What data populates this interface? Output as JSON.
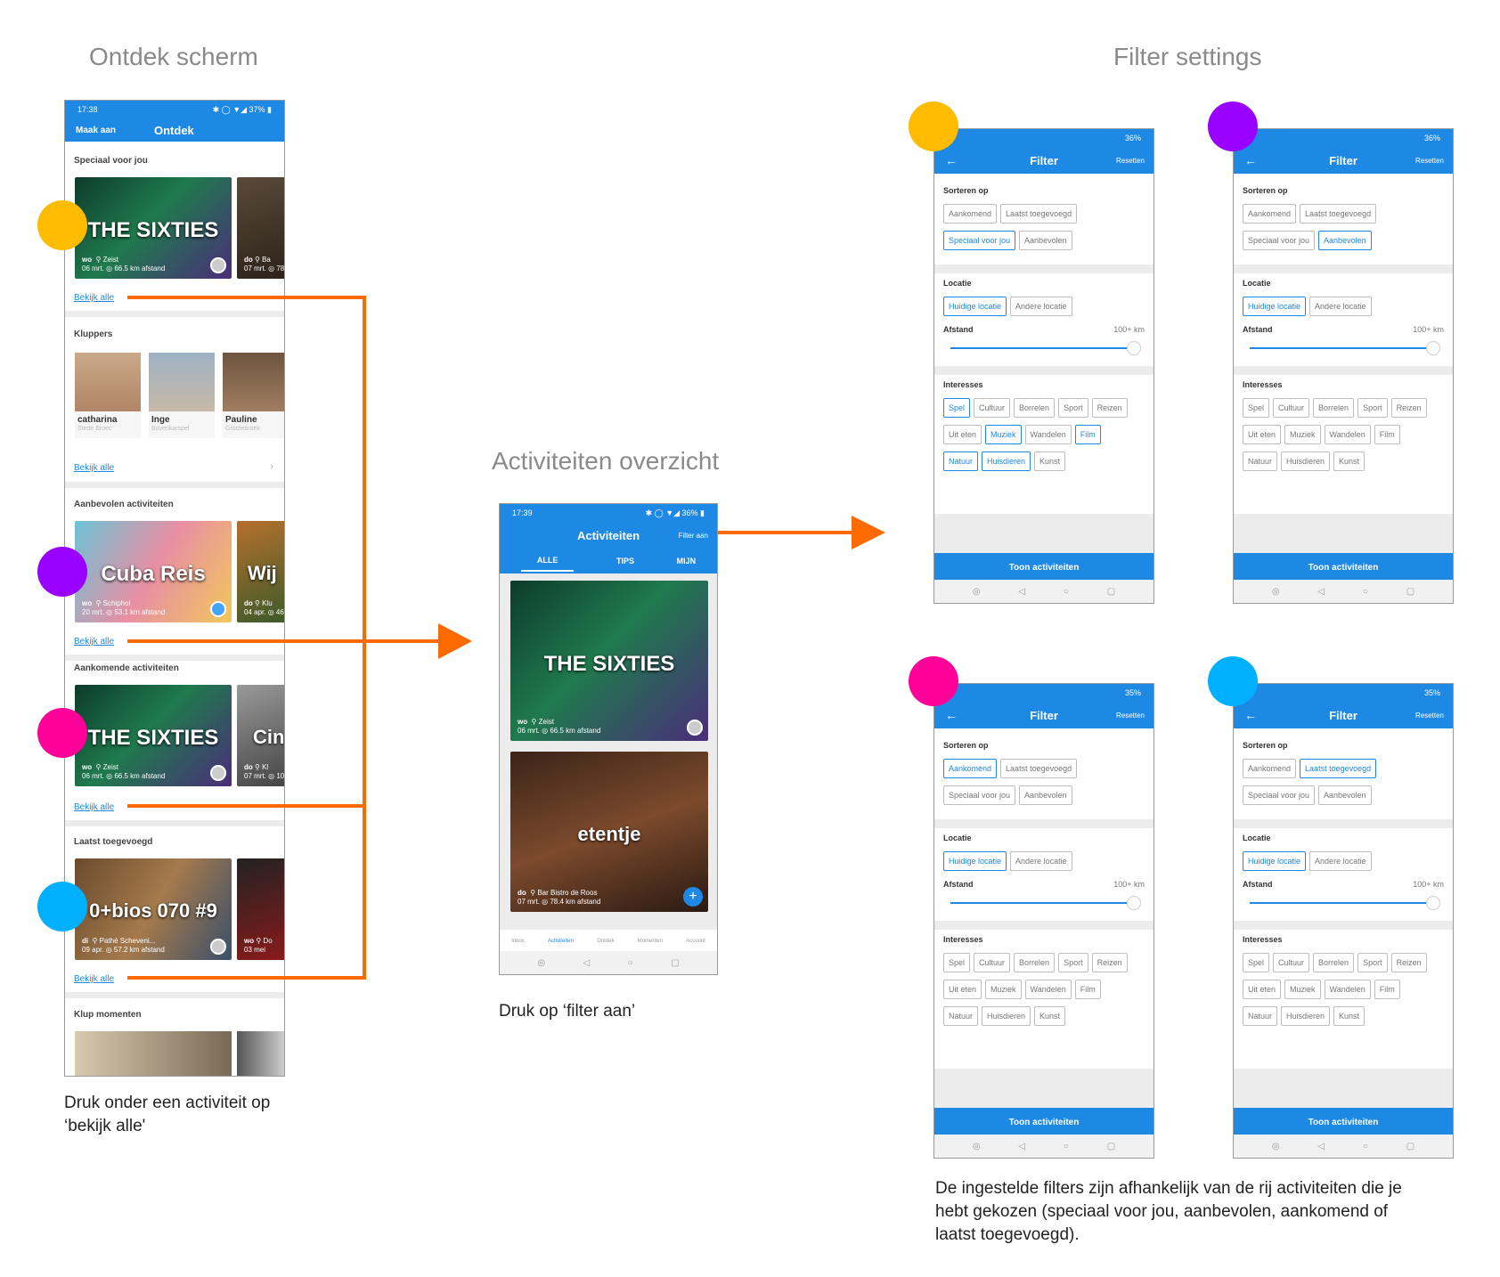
{
  "headings": {
    "ontdek": "Ontdek scherm",
    "overzicht": "Activiteiten overzicht",
    "filter": "Filter settings"
  },
  "captions": {
    "ontdek": [
      "Druk onder een activiteit op",
      "‘bekijk alle'"
    ],
    "overzicht": "Druk op ‘filter aan’",
    "filter": [
      "De ingestelde filters zijn afhankelijk van de rij activiteiten die je",
      "hebt gekozen (speciaal voor jou, aanbevolen, aankomend of",
      "laatst toegevoegd)."
    ]
  },
  "colors": {
    "accent_blue": "#1e88e5",
    "arrow_orange": "#ff6a00",
    "dot_yellow": "#ffbb00",
    "dot_purple": "#9900ff",
    "dot_pink": "#ff0099",
    "dot_cyan": "#00b0ff"
  },
  "ontdek_phone": {
    "status_time": "17:38",
    "status_right": "✱ ◯ ▼◢ 37% ▮",
    "maak_aan": "Maak aan",
    "title": "Ontdek",
    "bekijk_alle": "Bekijk alle",
    "sections": {
      "speciaal": "Speciaal voor jou",
      "kluppers": "Kluppers",
      "aanbevolen": "Aanbevolen activiteiten",
      "aankomend": "Aankomende activiteiten",
      "laatst": "Laatst toegevoegd",
      "momenten": "Klup momenten"
    },
    "cards": {
      "sixties": {
        "title": "THE SIXTIES",
        "day": "wo",
        "date": "06 mrt.",
        "place": "Zeist",
        "dist": "66.5 km afstand"
      },
      "cuba": {
        "title": "Cuba Reis",
        "day": "wo",
        "date": "20 mrt.",
        "place": "Schiphol",
        "dist": "53.1 km afstand"
      },
      "bios": {
        "title": "0+bios 070 #9",
        "day": "di",
        "date": "09 apr.",
        "place": "Pathé Scheveni...",
        "dist": "57.2 km afstand"
      },
      "peek_sixties": {
        "title": "",
        "day": "do",
        "date": "07 mrt.",
        "place": "Ba",
        "dist": "78"
      },
      "peek_wij": {
        "title": "Wij",
        "day": "do",
        "date": "04 apr.",
        "place": "Klu",
        "dist": "46"
      },
      "peek_cin": {
        "title": "Cin",
        "day": "do",
        "date": "07 mrt.",
        "place": "Kl",
        "dist": "10"
      },
      "peek_bios": {
        "title": "",
        "day": "wo",
        "date": "03 mei",
        "place": "Do",
        "dist": ""
      }
    },
    "kluppers": [
      {
        "name": "catharina",
        "place": "Stede Broec"
      },
      {
        "name": "Inge",
        "place": "Bovenkarspel"
      },
      {
        "name": "Pauline",
        "place": "Grootebroek"
      }
    ]
  },
  "activiteiten_phone": {
    "status_time": "17:39",
    "status_right": "✱ ◯ ▼◢ 36% ▮",
    "title": "Activiteiten",
    "filter_aan": "Filter aan",
    "tabs": [
      "ALLE",
      "TIPS",
      "MIJN"
    ],
    "cards": [
      {
        "title": "THE SIXTIES",
        "day": "wo",
        "date": "06 mrt.",
        "place": "Zeist",
        "dist": "66.5 km afstand"
      },
      {
        "title": "etentje",
        "day": "do",
        "date": "07 mrt.",
        "place": "Bar Bistro de Roos",
        "dist": "78.4 km afstand"
      }
    ],
    "bottom_nav": [
      "Inbox",
      "Activiteiten",
      "Ontdek",
      "Momenten",
      "Account"
    ]
  },
  "filter_common": {
    "title": "Filter",
    "resetten": "Resetten",
    "sorteren_op": "Sorteren op",
    "sort_options": [
      "Aankomend",
      "Laatst toegevoegd",
      "Speciaal voor jou",
      "Aanbevolen"
    ],
    "locatie": "Locatie",
    "locatie_options": [
      "Huidige locatie",
      "Andere locatie"
    ],
    "afstand": "Afstand",
    "afstand_value": "100+ km",
    "interesses": "Interesses",
    "interesse_options": [
      "Spel",
      "Cultuur",
      "Borrelen",
      "Sport",
      "Reizen",
      "Uit eten",
      "Muziek",
      "Wandelen",
      "Film",
      "Natuur",
      "Huisdieren",
      "Kunst"
    ],
    "toon": "Toon activiteiten"
  },
  "filter_screens": [
    {
      "status": "36%",
      "sort_selected": "Speciaal voor jou",
      "interest_selected": [
        "Spel",
        "Muziek",
        "Film",
        "Natuur",
        "Huisdieren"
      ]
    },
    {
      "status": "36%",
      "sort_selected": "Aanbevolen",
      "interest_selected": []
    },
    {
      "status": "35%",
      "sort_selected": "Aankomend",
      "interest_selected": []
    },
    {
      "status": "35%",
      "sort_selected": "Laatst toegevoegd",
      "interest_selected": []
    }
  ]
}
